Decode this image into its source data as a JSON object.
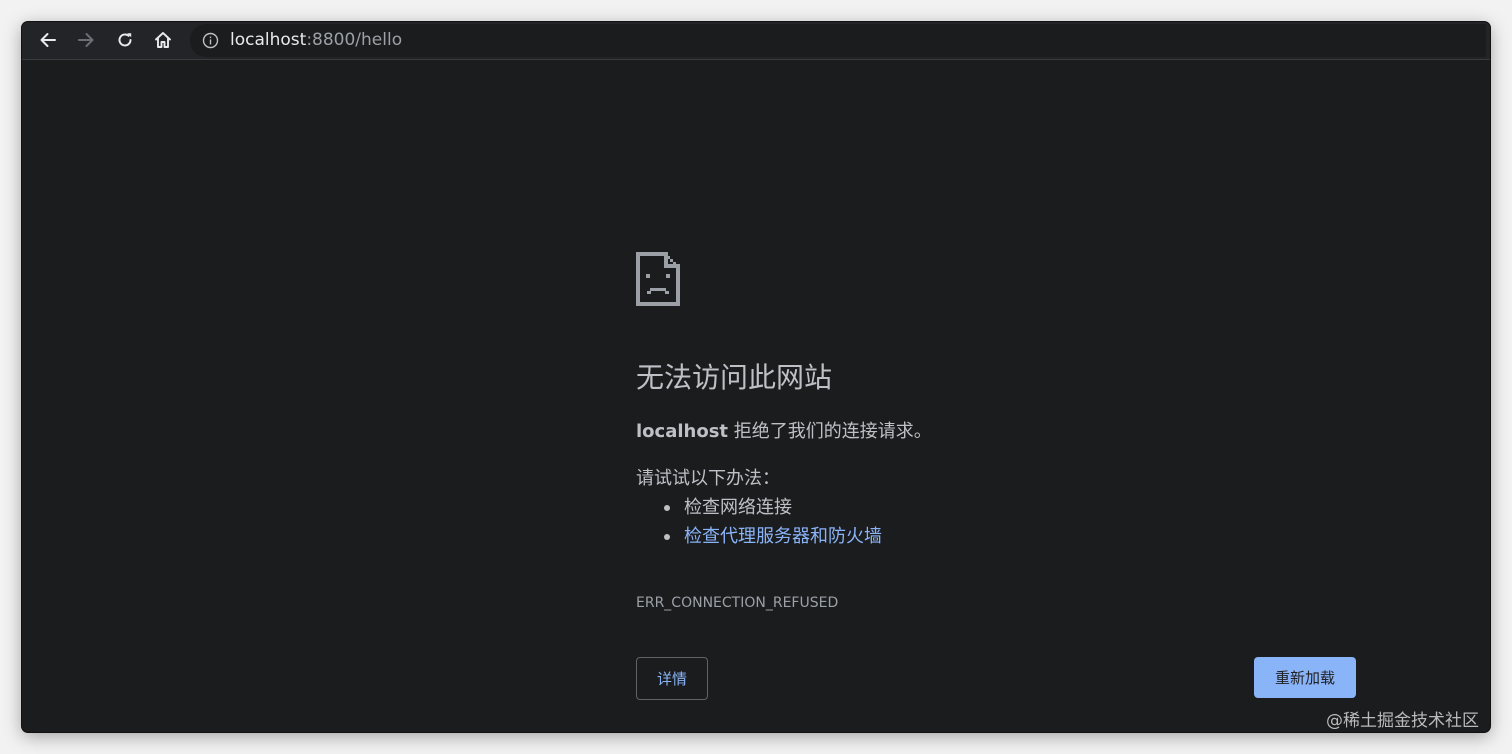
{
  "toolbar": {
    "back_icon": "arrow-left-icon",
    "forward_icon": "arrow-right-icon",
    "reload_icon": "reload-icon",
    "home_icon": "home-icon",
    "info_icon": "info-icon",
    "url_host": "localhost",
    "url_rest": ":8800/hello"
  },
  "error_page": {
    "icon": "sad-file-icon",
    "title": "无法访问此网站",
    "host": "localhost",
    "description_rest": " 拒绝了我们的连接请求。",
    "try_label": "请试试以下办法：",
    "suggestions": [
      {
        "text": "检查网络连接",
        "link": false
      },
      {
        "text": "检查代理服务器和防火墙",
        "link": true
      }
    ],
    "error_code": "ERR_CONNECTION_REFUSED",
    "details_label": "详情",
    "reload_label": "重新加载"
  },
  "watermark": "@稀土掘金技术社区",
  "colors": {
    "background": "#1b1c1e",
    "text": "#bdc1c6",
    "link": "#8ab4f8",
    "primary_button": "#8ab4f8"
  }
}
